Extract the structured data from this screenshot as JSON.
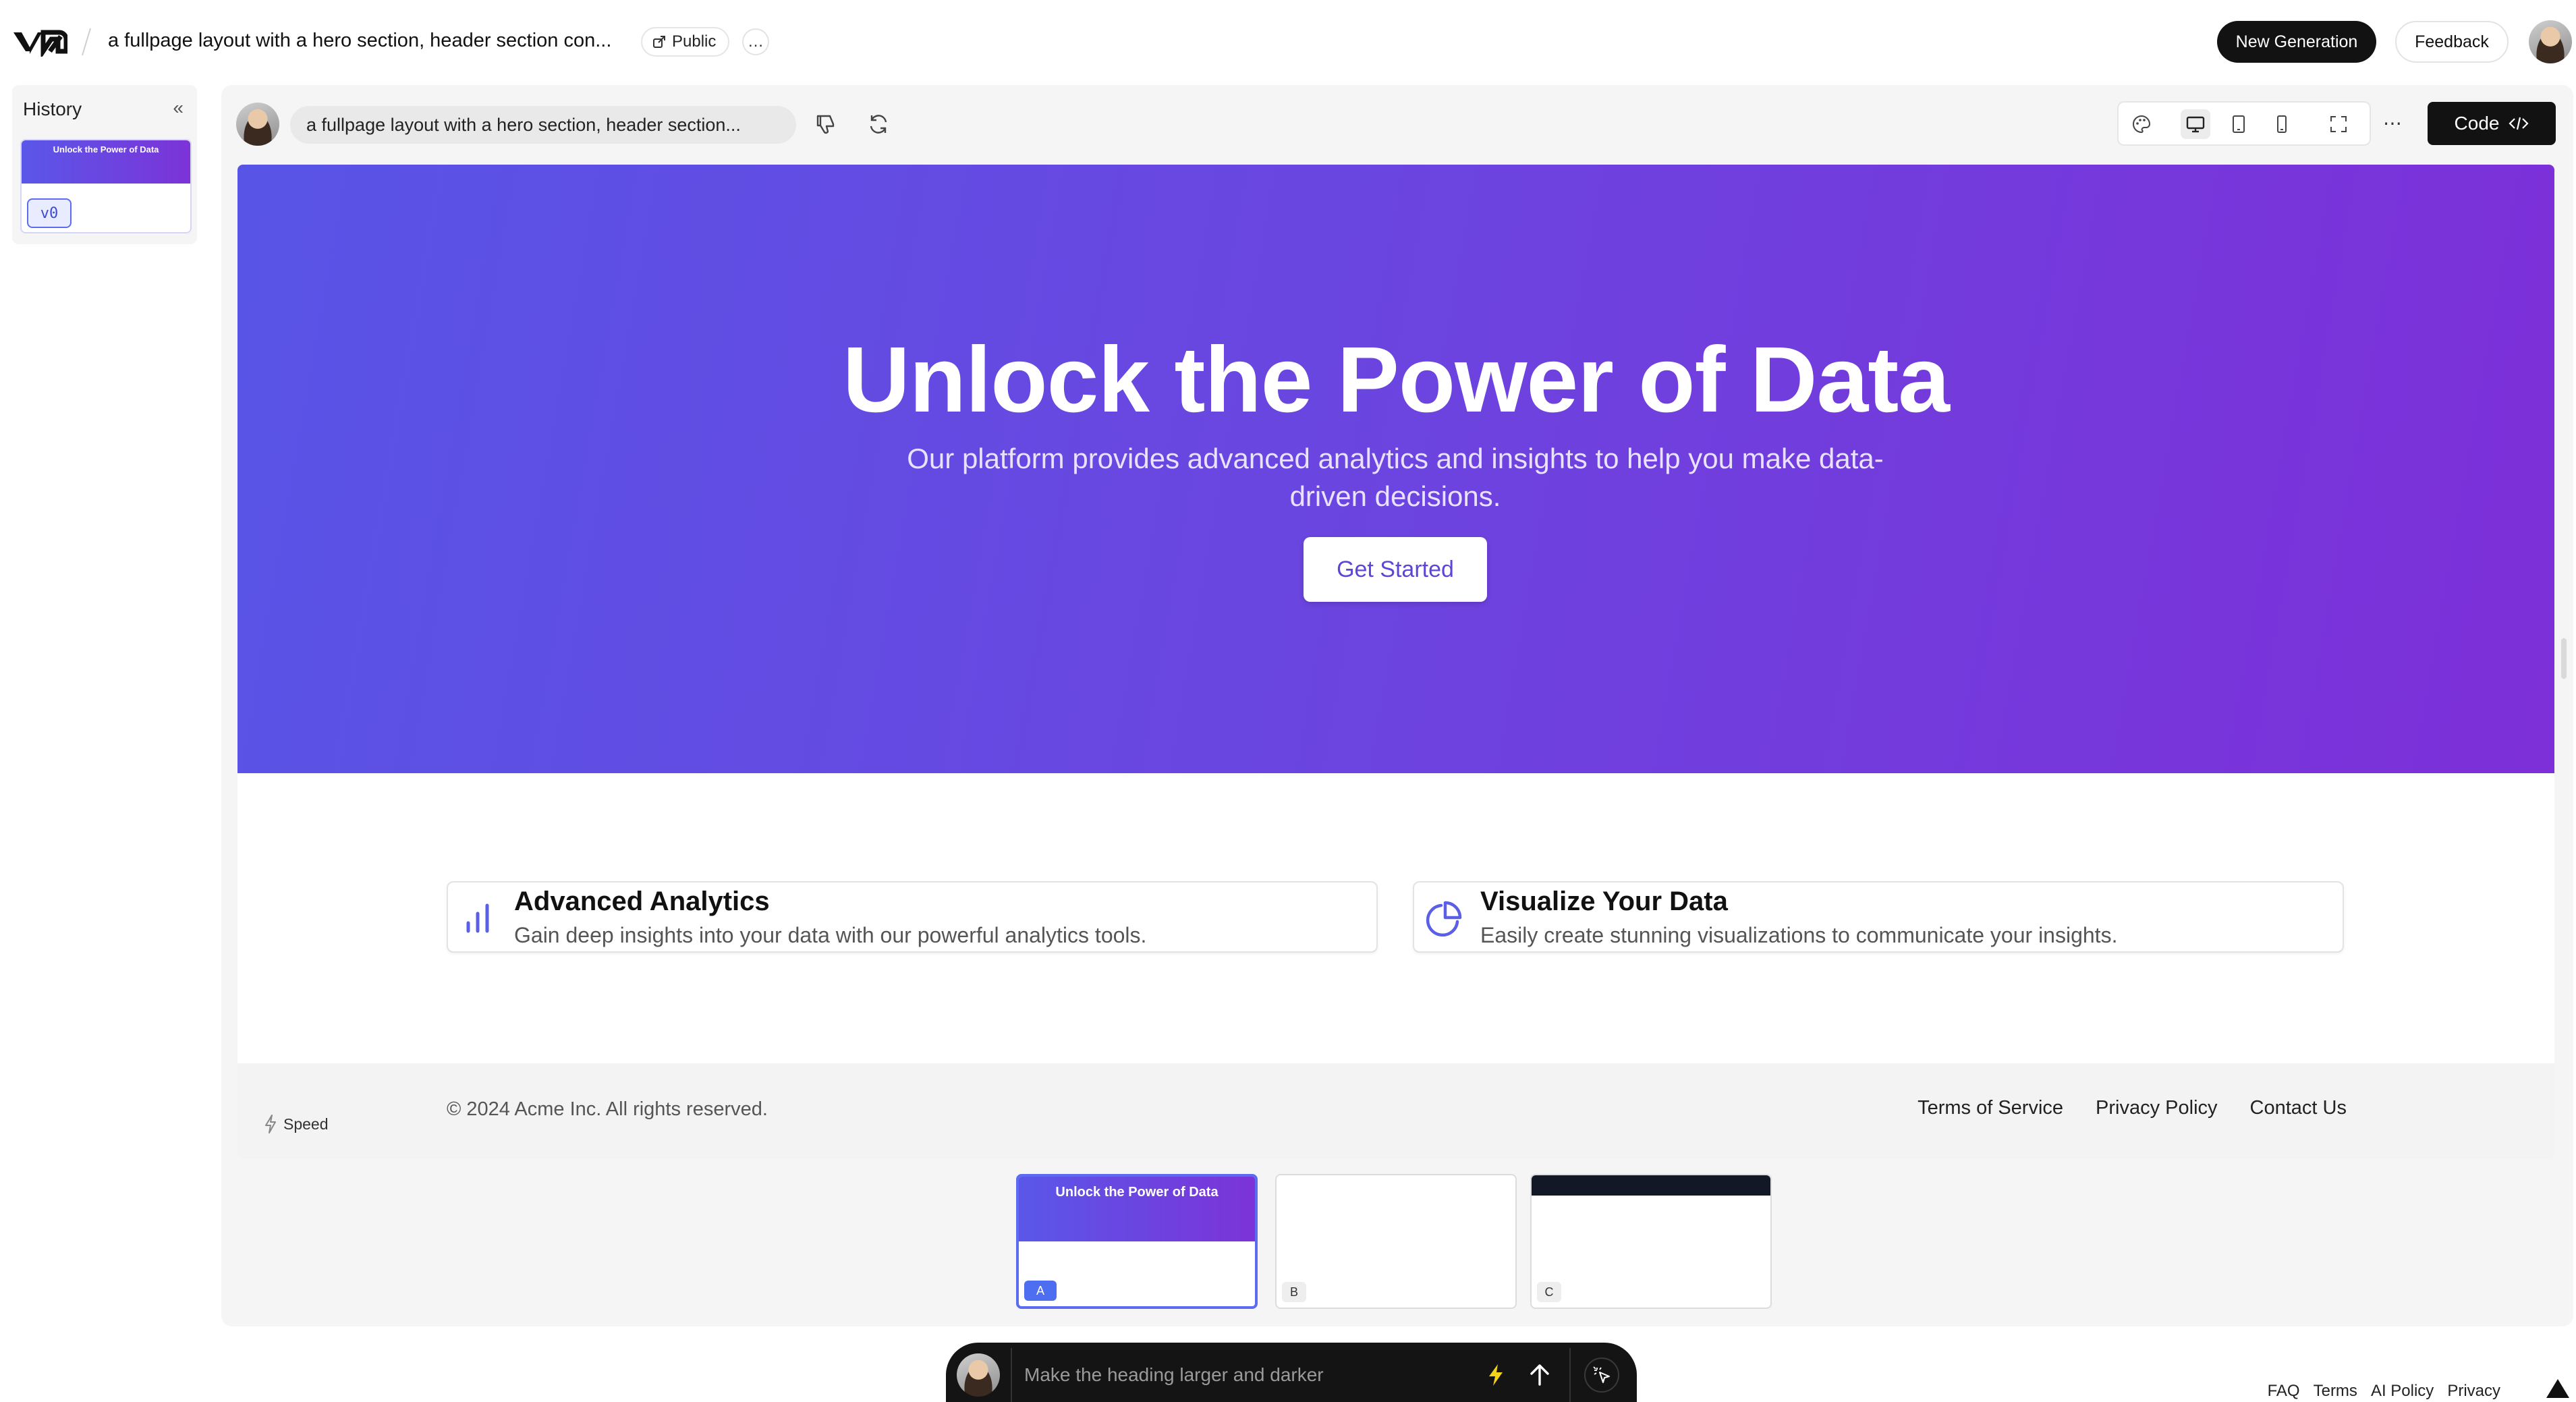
{
  "topbar": {
    "title": "a fullpage layout with a hero section, header section con...",
    "visibility": "Public",
    "more": "…",
    "new_generation": "New Generation",
    "feedback": "Feedback"
  },
  "history": {
    "title": "History",
    "thumb_title": "Unlock the Power of Data",
    "version": "v0"
  },
  "chat": {
    "prompt": "a fullpage layout with a hero section, header section..."
  },
  "toolbar": {
    "code_label": "Code",
    "more": "⋯"
  },
  "preview": {
    "hero": {
      "heading": "Unlock the Power of Data",
      "subheading": "Our platform provides advanced analytics and insights to help you make data-driven decisions.",
      "cta": "Get Started"
    },
    "features": [
      {
        "title": "Advanced Analytics",
        "description": "Gain deep insights into your data with our powerful analytics tools.",
        "icon": "bar-chart-icon"
      },
      {
        "title": "Visualize Your Data",
        "description": "Easily create stunning visualizations to communicate your insights.",
        "icon": "pie-chart-icon"
      }
    ],
    "footer": {
      "speed": "Speed",
      "copyright": "© 2024 Acme Inc. All rights reserved.",
      "links": [
        "Terms of Service",
        "Privacy Policy",
        "Contact Us"
      ]
    }
  },
  "variants": [
    {
      "label": "A",
      "title": "Unlock the Power of Data",
      "selected": true
    },
    {
      "label": "B",
      "selected": false
    },
    {
      "label": "C",
      "selected": false
    }
  ],
  "bottom_bar": {
    "placeholder": "Make the heading larger and darker"
  },
  "legal": [
    "FAQ",
    "Terms",
    "AI Policy",
    "Privacy"
  ],
  "colors": {
    "hero_start": "#5854e6",
    "hero_end": "#7d2fd8",
    "accent": "#5b6cf0",
    "dark": "#121212"
  }
}
